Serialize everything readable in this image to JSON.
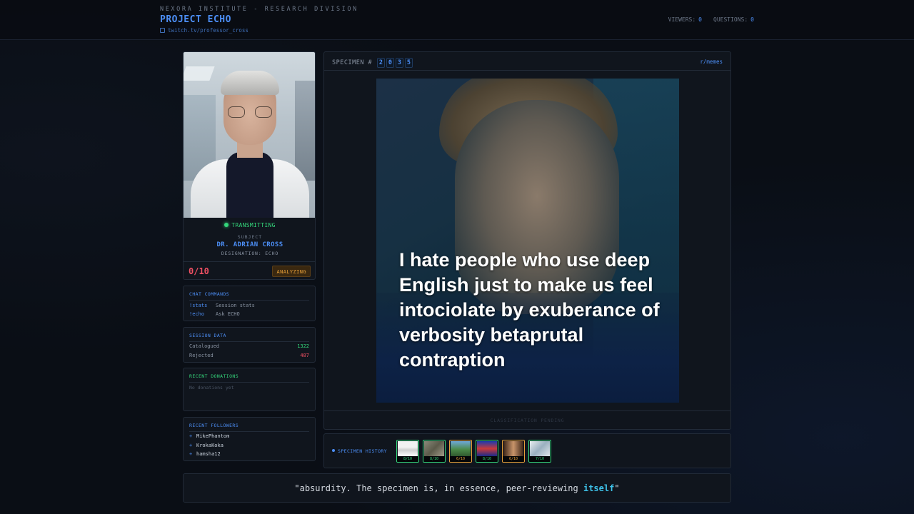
{
  "header": {
    "org": "NEXORA INSTITUTE - RESEARCH DIVISION",
    "project": "PROJECT ECHO",
    "channel": "twitch.tv/professor_cross",
    "viewers_label": "VIEWERS:",
    "viewers": "0",
    "questions_label": "QUESTIONS:",
    "questions": "0"
  },
  "profile": {
    "status": "TRANSMITTING",
    "subject_label": "SUBJECT",
    "name": "DR. ADRIAN CROSS",
    "designation": "DESIGNATION: ECHO",
    "score": "0/10",
    "badge": "ANALYZING"
  },
  "commands": {
    "title": "CHAT COMMANDS",
    "items": [
      {
        "cmd": "!stats",
        "desc": "Session stats"
      },
      {
        "cmd": "!echo",
        "desc": "Ask ECHO"
      }
    ]
  },
  "session": {
    "title": "SESSION DATA",
    "catalogued_label": "Catalogued",
    "catalogued": "1322",
    "rejected_label": "Rejected",
    "rejected": "487"
  },
  "donations": {
    "title": "RECENT DONATIONS",
    "empty": "No donations yet"
  },
  "followers": {
    "title": "RECENT FOLLOWERS",
    "items": [
      "MikePhantom",
      "KrokaKoka",
      "hamsha12"
    ]
  },
  "specimen": {
    "label": "SPECIMEN #",
    "digits": [
      "2",
      "0",
      "3",
      "5"
    ],
    "source": "r/memes",
    "caption": "I hate people who use deep English just to make us feel intociolate by exuberance of verbosity betaprutal contraption",
    "classification": "CLASSIFICATION PENDING"
  },
  "history": {
    "label": "SPECIMEN HISTORY",
    "items": [
      {
        "score": "8/10",
        "tone": "good"
      },
      {
        "score": "8/10",
        "tone": "good"
      },
      {
        "score": "6/10",
        "tone": "mid"
      },
      {
        "score": "8/10",
        "tone": "good"
      },
      {
        "score": "6/10",
        "tone": "mid"
      },
      {
        "score": "7/10",
        "tone": "good"
      }
    ]
  },
  "quote": {
    "text": "\"absurdity. The specimen is, in essence, peer-reviewing ",
    "highlight": "itself",
    "end": "\""
  }
}
